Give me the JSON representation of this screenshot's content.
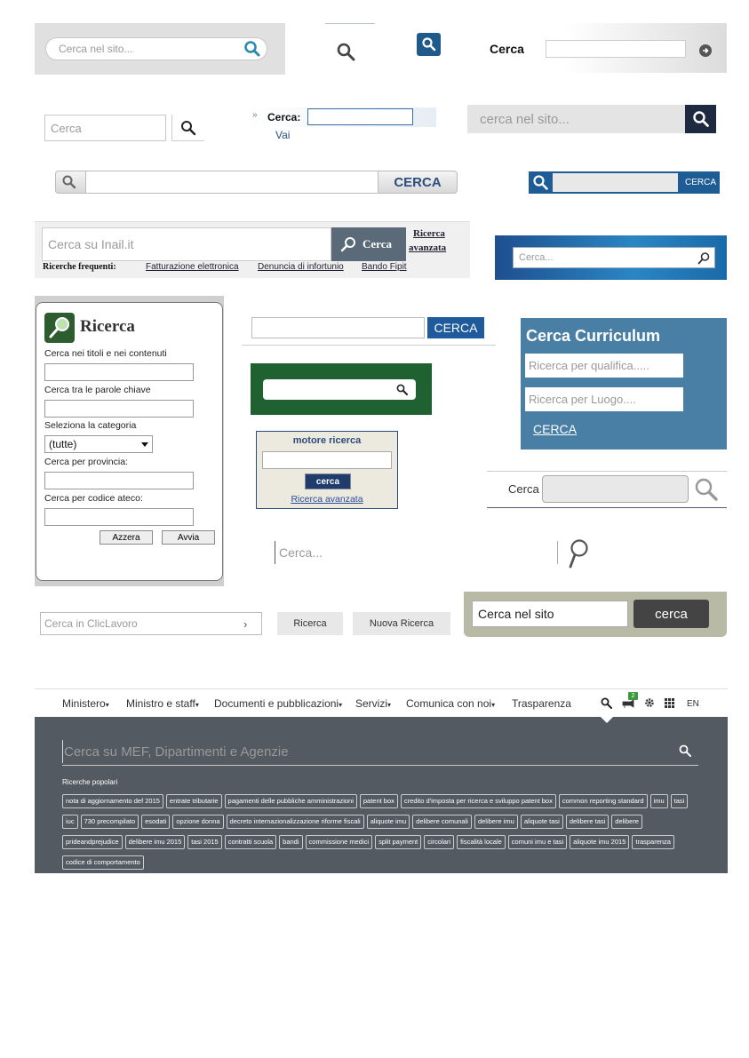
{
  "w1": {
    "placeholder": "Cerca nel sito..."
  },
  "w2": {
    "icon": "search-icon"
  },
  "w3": {
    "icon": "search-icon"
  },
  "w4": {
    "label": "Cerca",
    "arrow_icon": "arrow-right-icon"
  },
  "w5": {
    "placeholder": "Cerca"
  },
  "w6": {
    "label": "Cerca:",
    "go": "Vai"
  },
  "w7": {
    "placeholder": "cerca nel sito..."
  },
  "w8": {
    "button": "CERCA"
  },
  "w9": {
    "button": "CERCA"
  },
  "w10": {
    "placeholder": "Cerca su Inail.it",
    "button": "Cerca",
    "advanced": [
      "Ricerca",
      "avanzata"
    ],
    "frequent_label": "Ricerche frequenti:",
    "frequent_links": [
      "Fatturazione elettronica",
      "Denuncia di infortunio",
      "Bando Fipit"
    ]
  },
  "w11": {
    "placeholder": "Cerca..."
  },
  "w12": {
    "title": "Ricerca",
    "label_titles": "Cerca nei titoli e nei contenuti",
    "label_keywords": "Cerca tra le parole chiave",
    "label_category": "Seleziona la categoria",
    "category_value": "(tutte)",
    "label_province": "Cerca per provincia:",
    "label_ateco": "Cerca per codice ateco:",
    "reset": "Azzera",
    "submit": "Avvia"
  },
  "w13": {
    "button": "CERCA"
  },
  "w14": {
    "icon": "search-icon"
  },
  "w15": {
    "title": "motore ricerca",
    "button": "cerca",
    "advanced": "Ricerca avanzata"
  },
  "w16": {
    "title": "Cerca Curriculum",
    "placeholder_qualifica": "Ricerca per qualifica.....",
    "placeholder_luogo": "Ricerca per Luogo....",
    "button": "CERCA"
  },
  "w17": {
    "label": "Cerca"
  },
  "w18": {
    "placeholder": "Cerca..."
  },
  "w19": {
    "placeholder": "Cerca in ClicLavoro",
    "btn_search": "Ricerca",
    "btn_new": "Nuova Ricerca"
  },
  "w20": {
    "value": "Cerca nel sito",
    "button": "cerca"
  },
  "mef": {
    "nav": [
      {
        "label": "Ministero",
        "caret": "▾"
      },
      {
        "label": "Ministro e staff",
        "caret": "▾"
      },
      {
        "label": "Documenti e pubblicazioni",
        "caret": "▾"
      },
      {
        "label": "Servizi",
        "caret": "▾"
      },
      {
        "label": "Comunica con noi",
        "caret": "▾"
      },
      {
        "label": "Trasparenza",
        "caret": ""
      }
    ],
    "badge": "2",
    "lang": "EN",
    "placeholder": "Cerca su MEF, Dipartimenti e Agenzie",
    "popular_label": "Ricerche popolari",
    "tags": [
      "nota di aggiornamento def 2015",
      "entrate tributarie",
      "pagamenti delle pubbliche amministrazioni",
      "patent box",
      "credito d'imposta per ricerca e sviluppo patent box",
      "common reporting standard",
      "imu",
      "tasi",
      "iuc",
      "730 precompilato",
      "esodati",
      "opzione donna",
      "decreto internazionalizzazione riforme fiscali",
      "aliquote imu",
      "delibere comunali",
      "delibere imu",
      "aliquote tasi",
      "delibere tasi",
      "delibere",
      "prideandprejudice",
      "delibere imu 2015",
      "tasi 2015",
      "contratti scuola",
      "bandi",
      "commissione medici",
      "split payment",
      "circolari",
      "fiscalità locale",
      "comuni imu e tasi",
      "aliquote imu 2015",
      "trasparenza",
      "codice di comportamento"
    ]
  }
}
